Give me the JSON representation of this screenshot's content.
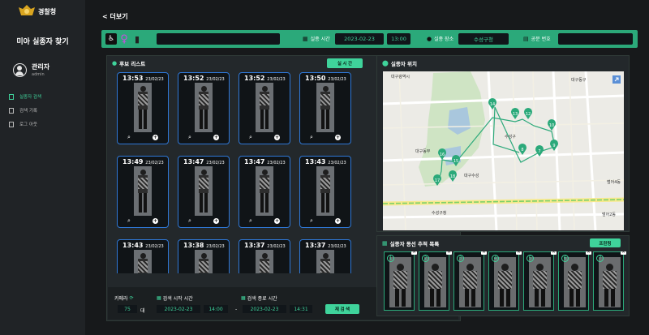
{
  "brand": {
    "name": "경찰청"
  },
  "sidebar": {
    "app_title": "미아 실종자 찾기",
    "user": {
      "name": "관리자",
      "id": "admin"
    },
    "menu": [
      {
        "label": "실종자 검색",
        "active": true
      },
      {
        "label": "검색 기록",
        "active": false
      },
      {
        "label": "로그 아웃",
        "active": false
      }
    ]
  },
  "header": {
    "back_label": "< 더보기"
  },
  "infobar": {
    "missing_time_label": "실종 시간",
    "missing_date": "2023-02-23",
    "missing_time": "13:00",
    "missing_place_label": "실종 장소",
    "missing_place": "수성구청",
    "doc_number_label": "공문 번호",
    "doc_number": ""
  },
  "candidates": {
    "title": "후보 리스트",
    "realtime_button": "실 시 간",
    "items": [
      {
        "time": "13:53",
        "date": "23/02/23"
      },
      {
        "time": "13:52",
        "date": "23/02/23"
      },
      {
        "time": "13:52",
        "date": "23/02/23"
      },
      {
        "time": "13:50",
        "date": "23/02/23"
      },
      {
        "time": "13:49",
        "date": "23/02/23"
      },
      {
        "time": "13:47",
        "date": "23/02/23"
      },
      {
        "time": "13:47",
        "date": "23/02/23"
      },
      {
        "time": "13:43",
        "date": "23/02/23"
      },
      {
        "time": "13:43",
        "date": "23/02/23"
      },
      {
        "time": "13:38",
        "date": "23/02/23"
      },
      {
        "time": "13:37",
        "date": "23/02/23"
      },
      {
        "time": "13:37",
        "date": "23/02/23"
      }
    ]
  },
  "search": {
    "camera_label": "카메라",
    "camera_count": "75",
    "camera_unit": "대",
    "start_label": "검색 시작 시간",
    "start_date": "2023-02-23",
    "start_time": "14:00",
    "range_sep": "-",
    "end_label": "검색 종료 시간",
    "end_date": "2023-02-23",
    "end_time": "14:31",
    "research_button": "재 검 색"
  },
  "map": {
    "title": "실종자 위치",
    "markers": [
      "14",
      "13",
      "12",
      "10",
      "9",
      "8",
      "7",
      "16",
      "15",
      "17",
      "18"
    ],
    "labels": [
      "대구광역시",
      "수성구청",
      "대구동부",
      "수성구",
      "대구수성",
      "범어2동",
      "대구동구",
      "범어4동"
    ]
  },
  "tracks": {
    "title": "실종자 동선 추적 목록",
    "print_button": "프린팅",
    "items": [
      "1",
      "2",
      "3",
      "4",
      "5",
      "6",
      "7",
      "8"
    ]
  },
  "colors": {
    "accent": "#3fd39b",
    "bar": "#2ba97a",
    "card_border": "#2f78d7",
    "panel": "#23282b"
  }
}
